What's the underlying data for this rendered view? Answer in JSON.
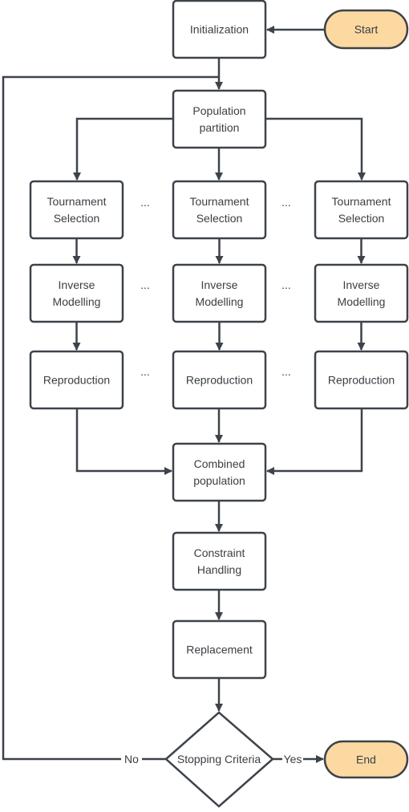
{
  "colors": {
    "stroke": "#3d434a",
    "terminal_fill": "#fdd9a2",
    "box_fill": "#ffffff",
    "text": "#3a3f44"
  },
  "nodes": {
    "start": "Start",
    "initialization": "Initialization",
    "partition": [
      "Population",
      "partition"
    ],
    "tournament": [
      "Tournament",
      "Selection"
    ],
    "inverse": [
      "Inverse",
      "Modelling"
    ],
    "reproduction": "Reproduction",
    "combined": [
      "Combined",
      "population"
    ],
    "constraint": [
      "Constraint",
      "Handling"
    ],
    "replacement": "Replacement",
    "decision": "Stopping Criteria",
    "end": "End",
    "ellipsis": "..."
  },
  "edges": {
    "no": "No",
    "yes": "Yes"
  }
}
